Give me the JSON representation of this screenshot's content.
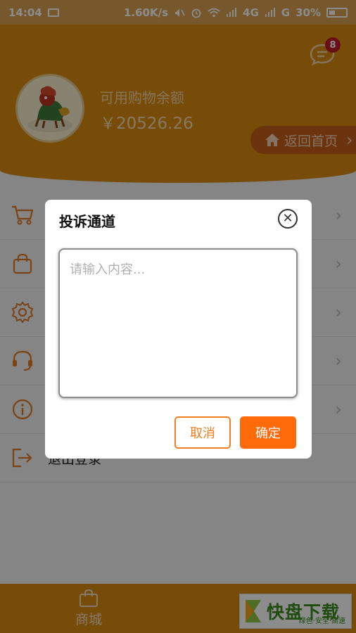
{
  "status_bar": {
    "time": "14:04",
    "network_speed": "1.60K/s",
    "signal_4g": "4G",
    "signal_g": "G",
    "battery": "30%"
  },
  "header": {
    "message_badge": "8",
    "balance_label": "可用购物余额",
    "balance_value": "￥20526.26",
    "home_button": "返回首页",
    "home_chevron": "›"
  },
  "menu": {
    "items": [
      {
        "icon": "cart-icon",
        "label": ""
      },
      {
        "icon": "bag-icon",
        "label": ""
      },
      {
        "icon": "gear-icon",
        "label": ""
      },
      {
        "icon": "headset-icon",
        "label": ""
      },
      {
        "icon": "info-icon",
        "label": ""
      },
      {
        "icon": "logout-icon",
        "label": "退出登录"
      }
    ],
    "chevron": "›"
  },
  "tabbar": {
    "tabs": [
      {
        "label": "商城",
        "icon": "shopping-bag-icon"
      }
    ]
  },
  "watermark": {
    "brand": "快盘下载",
    "slogan": "绿色·安全·高速"
  },
  "dialog": {
    "title": "投诉通道",
    "close": "✕",
    "placeholder": "请输入内容...",
    "cancel": "取消",
    "confirm": "确定"
  },
  "colors": {
    "header": "#d98a12",
    "accent": "#ff6a0a",
    "icon": "#e07b24"
  }
}
